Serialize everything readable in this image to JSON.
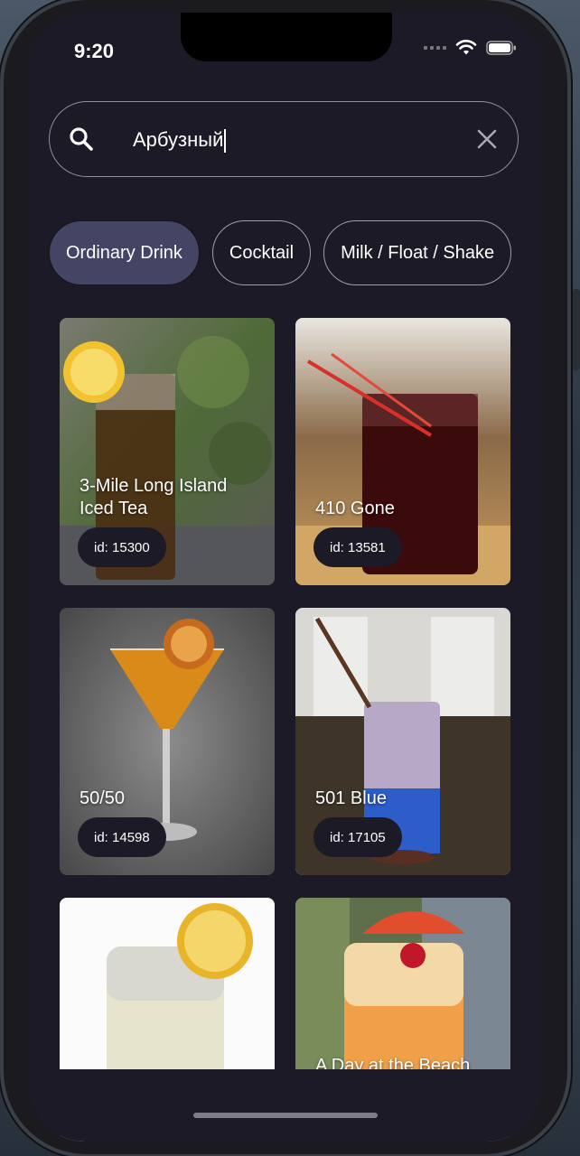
{
  "status_bar": {
    "time": "9:20"
  },
  "search": {
    "value": "Арбузный",
    "placeholder": ""
  },
  "categories": [
    {
      "label": "Ordinary Drink",
      "selected": true
    },
    {
      "label": "Cocktail",
      "selected": false
    },
    {
      "label": "Milk / Float / Shake",
      "selected": false
    }
  ],
  "drinks": [
    {
      "name": "3-Mile Long Island Iced Tea",
      "id_label": "id: 15300"
    },
    {
      "name": "410 Gone",
      "id_label": "id: 13581"
    },
    {
      "name": "50/50",
      "id_label": "id: 14598"
    },
    {
      "name": "501 Blue",
      "id_label": "id: 17105"
    },
    {
      "name": "",
      "id_label": ""
    },
    {
      "name": "A Day at the Beach",
      "id_label": ""
    }
  ],
  "colors": {
    "background": "#1b1a26",
    "chip_selected": "#444564",
    "chip_border": "#9c9cae",
    "id_badge": "#1b1a26"
  },
  "icons": [
    "search-icon",
    "clear-icon",
    "wifi-icon",
    "battery-icon",
    "signal-icon"
  ]
}
